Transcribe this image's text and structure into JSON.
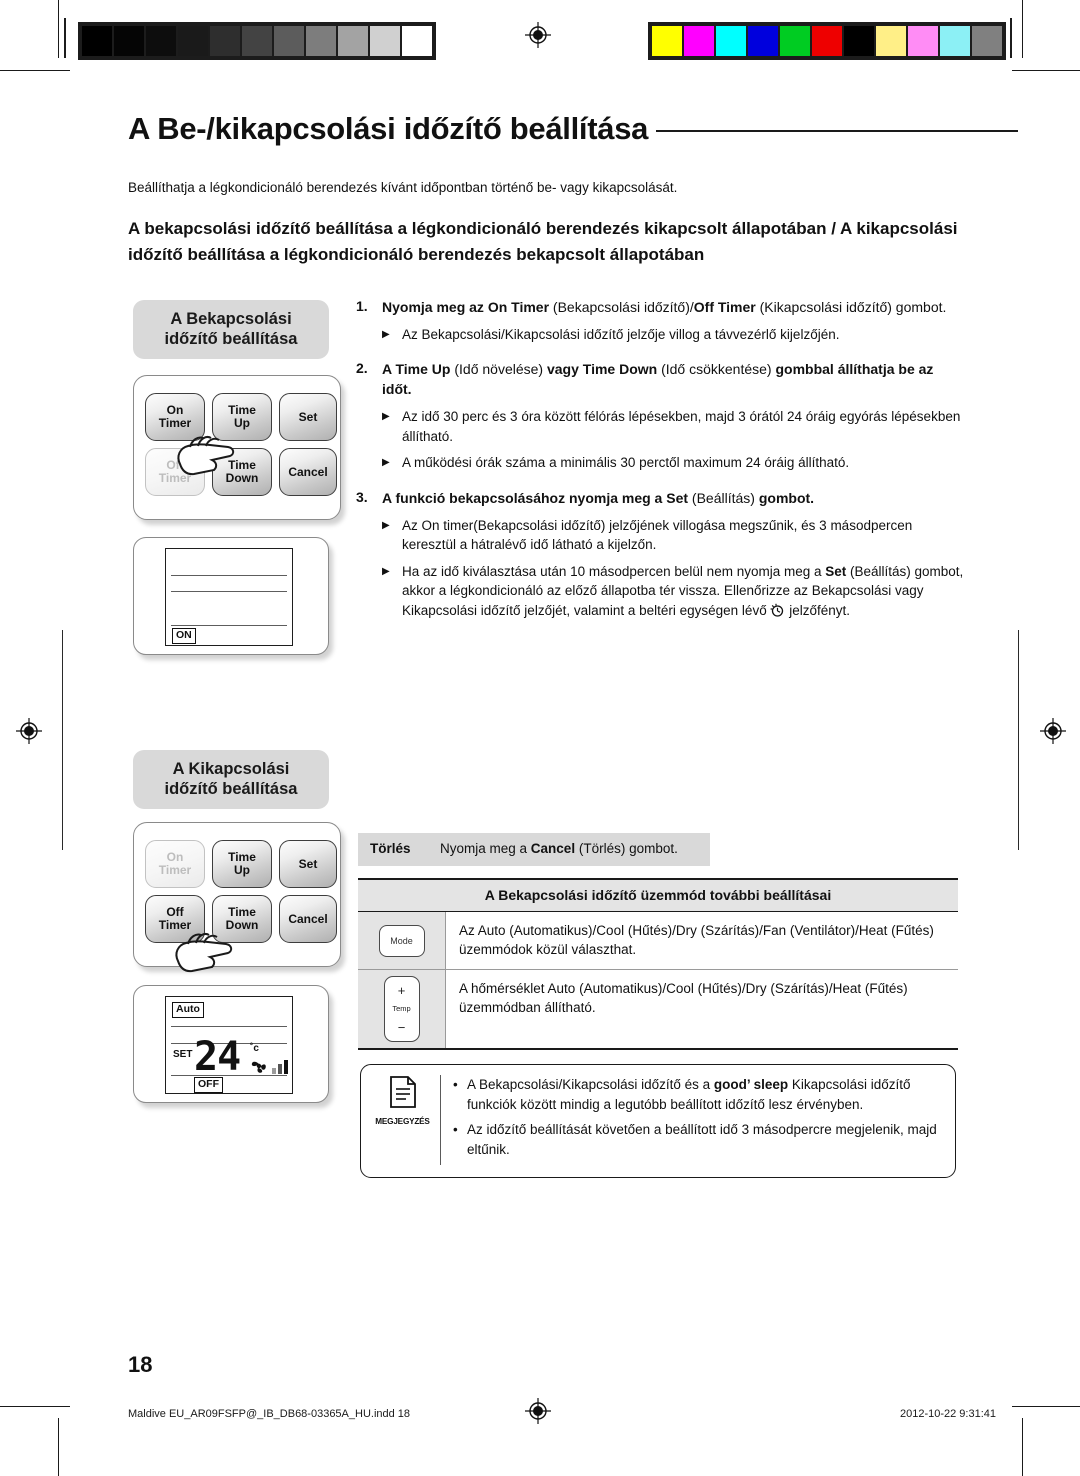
{
  "document": {
    "page_number": "18",
    "footer_file": "Maldive EU_AR09FSFP@_IB_DB68-03365A_HU.indd   18",
    "footer_timestamp": "2012-10-22   9:31:41"
  },
  "title": "A Be-/kikapcsolási időzítő beállítása",
  "intro": "Beállíthatja a légkondicionáló berendezés kívánt időpontban történő be- vagy kikapcsolását.",
  "section_heading": "A bekapcsolási időzítő beállítása a légkondicionáló berendezés kikapcsolt állapotában / A kikapcsolási időzítő beállítása a légkondicionáló berendezés bekapcsolt állapotában",
  "panels": {
    "on_timer": {
      "title_line1": "A Bekapcsolási",
      "title_line2": "időzítő beállítása"
    },
    "off_timer": {
      "title_line1": "A Kikapcsolási",
      "title_line2": "időzítő beállítása"
    }
  },
  "remote_buttons": {
    "on_timer_line1": "On",
    "on_timer_line2": "Timer",
    "time_up_line1": "Time",
    "time_up_line2": "Up",
    "set": "Set",
    "off_timer_line1": "Off",
    "off_timer_line2": "Timer",
    "time_down_line1": "Time",
    "time_down_line2": "Down",
    "cancel": "Cancel"
  },
  "lcd_on": {
    "indicator": "ON"
  },
  "lcd_off": {
    "mode": "Auto",
    "set_label": "SET",
    "temperature": "24",
    "unit": "˚c",
    "indicator": "OFF"
  },
  "steps": [
    {
      "number": "1.",
      "text_segments": [
        {
          "t": "Nyomja meg az ",
          "b": true
        },
        {
          "t": "On Timer",
          "b": true
        },
        {
          "t": " (Bekapcsolási időzítő)/",
          "b": false
        },
        {
          "t": "Off Timer",
          "b": true
        },
        {
          "t": " (Kikapcsolási időzítő) gombot.",
          "b": false
        }
      ],
      "bullets": [
        [
          {
            "t": "Az Bekapcsolási/Kikapcsolási időzítő jelzője villog a távvezérlő kijelzőjén.",
            "b": false
          }
        ]
      ]
    },
    {
      "number": "2.",
      "text_segments": [
        {
          "t": "A ",
          "b": true
        },
        {
          "t": "Time Up",
          "b": true
        },
        {
          "t": " (Idő növelése) ",
          "b": false
        },
        {
          "t": "vagy ",
          "b": true
        },
        {
          "t": "Time Down",
          "b": true
        },
        {
          "t": " (Idő csökkentése) ",
          "b": false
        },
        {
          "t": "gombbal állíthatja be az időt.",
          "b": true
        }
      ],
      "bullets": [
        [
          {
            "t": "Az idő 30 perc és 3 óra között félórás lépésekben, majd 3 órától 24 óráig egyórás lépésekben állítható.",
            "b": false
          }
        ],
        [
          {
            "t": "A működési órák száma a minimális 30 perctől maximum 24 óráig állítható.",
            "b": false
          }
        ]
      ]
    },
    {
      "number": "3.",
      "text_segments": [
        {
          "t": "A funkció bekapcsolásához nyomja meg a ",
          "b": true
        },
        {
          "t": "Set",
          "b": true
        },
        {
          "t": " (Beállítás) ",
          "b": false
        },
        {
          "t": "gombot.",
          "b": true
        }
      ],
      "bullets": [
        [
          {
            "t": "Az On timer(Bekapcsolási időzítő) jelzőjének villogása megszűnik, és 3 másodpercen keresztül a hátralévő idő látható a kijelzőn.",
            "b": false
          }
        ],
        [
          {
            "t": "Ha az idő kiválasztása után 10 másodpercen belül nem nyomja meg a ",
            "b": false
          },
          {
            "t": "Set",
            "b": true
          },
          {
            "t": " (Beállítás) gombot, akkor a légkondicionáló az előző állapotba tér vissza. Ellenőrizze az Bekapcsolási vagy Kikapcsolási időzítő jelzőjét, valamint a beltéri egységen lévő ",
            "b": false
          },
          {
            "t": "[timer-icon]",
            "b": false
          },
          {
            "t": " jelzőfényt.",
            "b": false
          }
        ]
      ]
    }
  ],
  "cancel_strip": {
    "label": "Törlés",
    "text_before": "Nyomja meg a ",
    "text_bold": "Cancel",
    "text_after": " (Törlés) gombot."
  },
  "settings_table": {
    "header": "A Bekapcsolási időzítő üzemmód további beállításai",
    "rows": [
      {
        "icon_label": "Mode",
        "icon_name": "mode-button-icon",
        "text": "Az Auto (Automatikus)/Cool (Hűtés)/Dry (Szárítás)/Fan (Ventilátor)/Heat (Fűtés) üzemmódok közül választhat."
      },
      {
        "icon_label": "Temp",
        "icon_plus": "+",
        "icon_minus": "−",
        "icon_name": "temp-button-icon",
        "text": "A hőmérséklet Auto (Automatikus)/Cool (Hűtés)/Dry (Szárítás)/Heat (Fűtés) üzemmódban állítható."
      }
    ]
  },
  "note": {
    "caption": "MEGJEGYZÉS",
    "items": [
      [
        {
          "t": "A Bekapcsolási/Kikapcsolási időzítő és a ",
          "b": false
        },
        {
          "t": "good’ sleep",
          "b": true
        },
        {
          "t": " Kikapcsolási időzítő funkciók között mindig a legutóbb beállított időzítő lesz érvényben.",
          "b": false
        }
      ],
      [
        {
          "t": "Az időzítő beállítását követően a beállított idő 3 másodpercre megjelenik, majd eltűnik.",
          "b": false
        }
      ]
    ]
  },
  "calibration": {
    "gray_swatches": [
      "#000000",
      "#050505",
      "#0d0d0d",
      "#1a1a1a",
      "#2e2e2e",
      "#434343",
      "#5c5c5c",
      "#7d7d7d",
      "#a3a3a3",
      "#d0d0d0",
      "#ffffff"
    ],
    "color_swatches": [
      "#ffff00",
      "#ff00ff",
      "#00ffff",
      "#0000dd",
      "#00cc22",
      "#ee0000",
      "#000000",
      "#ffef87",
      "#ff8cf5",
      "#8cf0f5",
      "#808080"
    ]
  }
}
